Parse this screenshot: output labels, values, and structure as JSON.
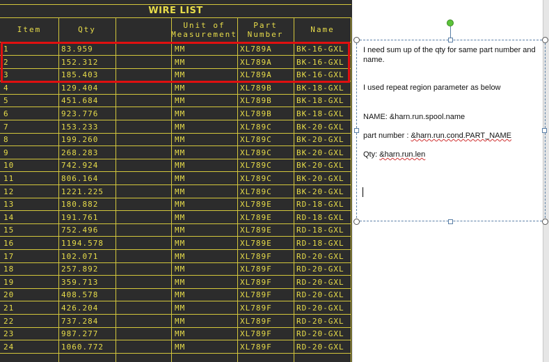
{
  "table": {
    "title": "WIRE LIST",
    "headers": {
      "item": "Item",
      "qty": "Qty",
      "unit": "Unit of\nMeasurement",
      "part": "Part\nNumber",
      "name": "Name"
    },
    "rows": [
      {
        "item": "1",
        "qty": "83.959",
        "unit": "MM",
        "part": "XL789A",
        "name": "BK-16-GXL"
      },
      {
        "item": "2",
        "qty": "152.312",
        "unit": "MM",
        "part": "XL789A",
        "name": "BK-16-GXL"
      },
      {
        "item": "3",
        "qty": "185.403",
        "unit": "MM",
        "part": "XL789A",
        "name": "BK-16-GXL"
      },
      {
        "item": "4",
        "qty": "129.404",
        "unit": "MM",
        "part": "XL789B",
        "name": "BK-18-GXL"
      },
      {
        "item": "5",
        "qty": "451.684",
        "unit": "MM",
        "part": "XL789B",
        "name": "BK-18-GXL"
      },
      {
        "item": "6",
        "qty": "923.776",
        "unit": "MM",
        "part": "XL789B",
        "name": "BK-18-GXL"
      },
      {
        "item": "7",
        "qty": "153.233",
        "unit": "MM",
        "part": "XL789C",
        "name": "BK-20-GXL"
      },
      {
        "item": "8",
        "qty": "199.260",
        "unit": "MM",
        "part": "XL789C",
        "name": "BK-20-GXL"
      },
      {
        "item": "9",
        "qty": "268.283",
        "unit": "MM",
        "part": "XL789C",
        "name": "BK-20-GXL"
      },
      {
        "item": "10",
        "qty": "742.924",
        "unit": "MM",
        "part": "XL789C",
        "name": "BK-20-GXL"
      },
      {
        "item": "11",
        "qty": "806.164",
        "unit": "MM",
        "part": "XL789C",
        "name": "BK-20-GXL"
      },
      {
        "item": "12",
        "qty": "1221.225",
        "unit": "MM",
        "part": "XL789C",
        "name": "BK-20-GXL"
      },
      {
        "item": "13",
        "qty": "180.882",
        "unit": "MM",
        "part": "XL789E",
        "name": "RD-18-GXL"
      },
      {
        "item": "14",
        "qty": "191.761",
        "unit": "MM",
        "part": "XL789E",
        "name": "RD-18-GXL"
      },
      {
        "item": "15",
        "qty": "752.496",
        "unit": "MM",
        "part": "XL789E",
        "name": "RD-18-GXL"
      },
      {
        "item": "16",
        "qty": "1194.578",
        "unit": "MM",
        "part": "XL789E",
        "name": "RD-18-GXL"
      },
      {
        "item": "17",
        "qty": "102.071",
        "unit": "MM",
        "part": "XL789F",
        "name": "RD-20-GXL"
      },
      {
        "item": "18",
        "qty": "257.892",
        "unit": "MM",
        "part": "XL789F",
        "name": "RD-20-GXL"
      },
      {
        "item": "19",
        "qty": "359.713",
        "unit": "MM",
        "part": "XL789F",
        "name": "RD-20-GXL"
      },
      {
        "item": "20",
        "qty": "408.578",
        "unit": "MM",
        "part": "XL789F",
        "name": "RD-20-GXL"
      },
      {
        "item": "21",
        "qty": "426.204",
        "unit": "MM",
        "part": "XL789F",
        "name": "RD-20-GXL"
      },
      {
        "item": "22",
        "qty": "737.284",
        "unit": "MM",
        "part": "XL789F",
        "name": "RD-20-GXL"
      },
      {
        "item": "23",
        "qty": "987.277",
        "unit": "MM",
        "part": "XL789F",
        "name": "RD-20-GXL"
      },
      {
        "item": "24",
        "qty": "1060.772",
        "unit": "MM",
        "part": "XL789F",
        "name": "RD-20-GXL"
      }
    ]
  },
  "note": {
    "line1": "I need  sum up  of the qty  for same part number and name.",
    "line2": "I used repeat region parameter as below",
    "name_label": "NAME:   ",
    "name_value": "&harn.run.spool.name",
    "part_label": "part number :   ",
    "part_value": "&harn.run.cond.PART_NAME",
    "qty_label": "Qty:  ",
    "qty_value": "&harn.run.len"
  },
  "colors": {
    "table_bg": "#2c2c2c",
    "table_text": "#e8dd4a",
    "highlight": "#e01010",
    "rotate_handle": "#5cc33a"
  },
  "icons": {
    "rotate": "rotate-handle-icon",
    "resize": "resize-handle-icon"
  }
}
